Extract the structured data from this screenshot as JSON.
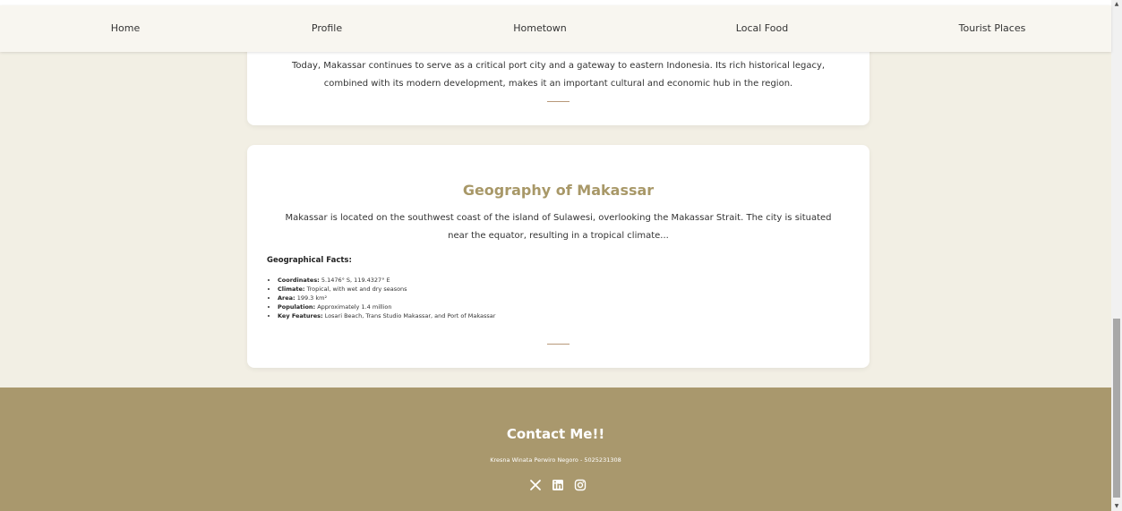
{
  "nav": {
    "items": [
      {
        "label": "Home"
      },
      {
        "label": "Profile"
      },
      {
        "label": "Hometown"
      },
      {
        "label": "Local Food"
      },
      {
        "label": "Tourist Places"
      }
    ]
  },
  "history_card": {
    "paragraph": "Today, Makassar continues to serve as a critical port city and a gateway to eastern Indonesia. Its rich historical legacy, combined with its modern development, makes it an important cultural and economic hub in the region."
  },
  "geography_card": {
    "title": "Geography of Makassar",
    "paragraph": "Makassar is located on the southwest coast of the island of Sulawesi, overlooking the Makassar Strait. The city is situated near the equator, resulting in a tropical climate...",
    "facts_heading": "Geographical Facts:",
    "facts": [
      {
        "label": "Coordinates:",
        "value": " 5.1476° S, 119.4327° E"
      },
      {
        "label": "Climate:",
        "value": " Tropical, with wet and dry seasons"
      },
      {
        "label": "Area:",
        "value": " 199.3 km²"
      },
      {
        "label": "Population:",
        "value": " Approximately 1.4 million"
      },
      {
        "label": "Key Features:",
        "value": " Losari Beach, Trans Studio Makassar, and Port of Makassar"
      }
    ]
  },
  "footer": {
    "title": "Contact Me!!",
    "subtitle": "Kresna Winata Perwiro Negoro - 5025231308",
    "social_icons": [
      "x-icon",
      "linkedin-icon",
      "instagram-icon"
    ]
  },
  "colors": {
    "accent": "#a89868",
    "footer_bg": "#a9986d",
    "page_bg": "#f2efe4",
    "divider": "#b8997a"
  }
}
